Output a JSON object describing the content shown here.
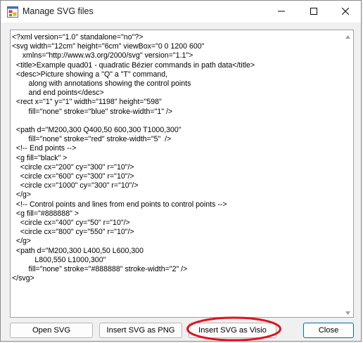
{
  "window": {
    "title": "Manage SVG files"
  },
  "editor": {
    "lines": [
      "<?xml version=\"1.0\" standalone=\"no\"?>",
      "<svg width=\"12cm\" height=\"6cm\" viewBox=\"0 0 1200 600\"",
      "     xmlns=\"http://www.w3.org/2000/svg\" version=\"1.1\">",
      "  <title>Example quad01 - quadratic Bézier commands in path data</title>",
      "  <desc>Picture showing a \"Q\" a \"T\" command,",
      "        along with annotations showing the control points",
      "        and end points</desc>",
      "  <rect x=\"1\" y=\"1\" width=\"1198\" height=\"598\"",
      "        fill=\"none\" stroke=\"blue\" stroke-width=\"1\" />",
      "",
      "  <path d=\"M200,300 Q400,50 600,300 T1000,300\"",
      "        fill=\"none\" stroke=\"red\" stroke-width=\"5\"  />",
      "  <!-- End points -->",
      "  <g fill=\"black\" >",
      "    <circle cx=\"200\" cy=\"300\" r=\"10\"/>",
      "    <circle cx=\"600\" cy=\"300\" r=\"10\"/>",
      "    <circle cx=\"1000\" cy=\"300\" r=\"10\"/>",
      "  </g>",
      "  <!-- Control points and lines from end points to control points -->",
      "  <g fill=\"#888888\" >",
      "    <circle cx=\"400\" cy=\"50\" r=\"10\"/>",
      "    <circle cx=\"800\" cy=\"550\" r=\"10\"/>",
      "  </g>",
      "  <path d=\"M200,300 L400,50 L600,300",
      "           L800,550 L1000,300\"",
      "        fill=\"none\" stroke=\"#888888\" stroke-width=\"2\" />",
      "</svg>"
    ]
  },
  "buttons": {
    "open_svg": "Open SVG",
    "insert_png": "Insert SVG as PNG",
    "insert_visio": "Insert SVG as Visio",
    "close": "Close"
  },
  "icons": {
    "app": "app-icon",
    "minimize": "minimize-icon",
    "maximize": "maximize-icon",
    "close": "close-icon",
    "scroll_up": "scroll-up-arrow-icon",
    "scroll_down": "scroll-down-arrow-icon"
  },
  "colors": {
    "annotation": "#e0141e",
    "default_button_border": "#0067c0"
  }
}
